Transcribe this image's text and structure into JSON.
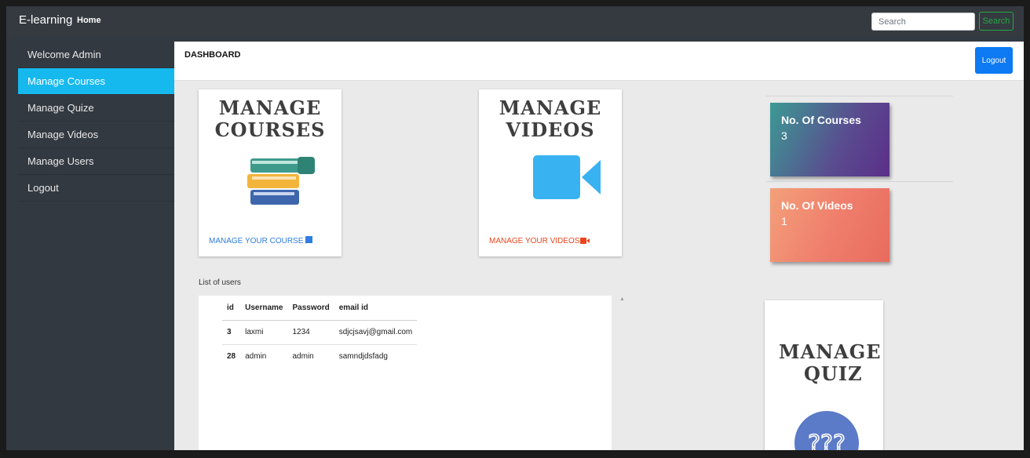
{
  "navbar": {
    "brand": "E-learning",
    "home": "Home",
    "search_placeholder": "Search",
    "search_button": "Search"
  },
  "sidebar": {
    "items": [
      {
        "label": "Welcome Admin"
      },
      {
        "label": "Manage Courses",
        "active": true
      },
      {
        "label": "Manage Quize"
      },
      {
        "label": "Manage Videos"
      },
      {
        "label": "Manage Users"
      },
      {
        "label": "Logout"
      }
    ]
  },
  "header": {
    "title": "DASHBOARD",
    "logout": "Logout"
  },
  "cards": {
    "courses": {
      "title_line1": "MANAGE",
      "title_line2": "COURSES",
      "link": "MANAGE YOUR COURSE",
      "icon": "book-icon",
      "color": "#2f7de1"
    },
    "videos": {
      "title_line1": "MANAGE",
      "title_line2": "VIDEOS",
      "link": "MANAGE YOUR VIDEOS",
      "icon": "video-camera-icon",
      "color": "#e8461e"
    },
    "quiz": {
      "title_line1": "MANAGE",
      "title_line2": "QUIZ",
      "icon": "question-marks-icon"
    }
  },
  "stats": {
    "courses": {
      "label": "No. Of Courses",
      "value": "3"
    },
    "videos": {
      "label": "No. Of Videos",
      "value": "1"
    }
  },
  "users": {
    "label": "List of users",
    "columns": [
      "id",
      "Username",
      "Password",
      "email id"
    ],
    "rows": [
      {
        "id": "3",
        "username": "laxmi",
        "password": "1234",
        "email": "sdjcjsavj@gmail.com"
      },
      {
        "id": "28",
        "username": "admin",
        "password": "admin",
        "email": "samndjdsfadg"
      }
    ]
  },
  "colors": {
    "sidebar_active": "#16b9ee",
    "primary_button": "#0d79f2",
    "search_button": "#28a745"
  }
}
